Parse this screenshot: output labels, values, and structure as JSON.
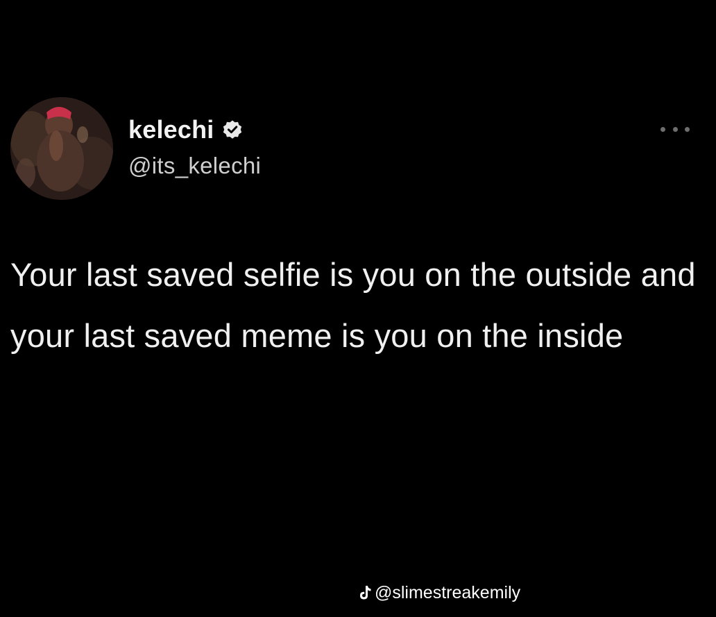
{
  "tweet": {
    "display_name": "kelechi",
    "handle": "@its_kelechi",
    "text": "Your last saved selfie is you on the outside and your last saved meme is you on the inside",
    "verified": true,
    "icons": {
      "verified": "verified-badge-icon",
      "more": "more-options-icon"
    }
  },
  "watermark": {
    "text": "@slimestreakemily",
    "icon": "tiktok-icon"
  },
  "colors": {
    "background": "#000000",
    "text": "#f0f0f0",
    "handle": "#cfcfcf",
    "more_dots": "#6e6e6e"
  }
}
